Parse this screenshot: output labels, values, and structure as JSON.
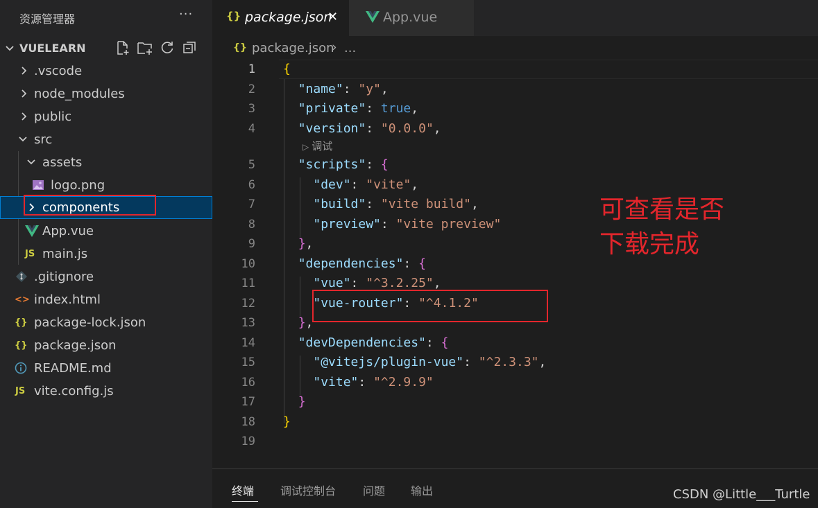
{
  "explorer": {
    "title": "资源管理器",
    "more_label": "···",
    "project_name": "VUELEARN",
    "tree": [
      {
        "label": ".vscode",
        "kind": "folder",
        "expanded": false
      },
      {
        "label": "node_modules",
        "kind": "folder",
        "expanded": false
      },
      {
        "label": "public",
        "kind": "folder",
        "expanded": false
      },
      {
        "label": "src",
        "kind": "folder",
        "expanded": true
      },
      {
        "label": "assets",
        "kind": "folder",
        "expanded": true
      },
      {
        "label": "logo.png",
        "kind": "image"
      },
      {
        "label": "components",
        "kind": "folder",
        "expanded": false,
        "selected": true
      },
      {
        "label": "App.vue",
        "kind": "vue"
      },
      {
        "label": "main.js",
        "kind": "js",
        "icon_text": "JS"
      },
      {
        "label": ".gitignore",
        "kind": "git"
      },
      {
        "label": "index.html",
        "kind": "html",
        "icon_text": "<>"
      },
      {
        "label": "package-lock.json",
        "kind": "json",
        "icon_text": "{}"
      },
      {
        "label": "package.json",
        "kind": "json",
        "icon_text": "{}"
      },
      {
        "label": "README.md",
        "kind": "info"
      },
      {
        "label": "vite.config.js",
        "kind": "js",
        "icon_text": "JS"
      }
    ]
  },
  "tabs": [
    {
      "label": "package.json",
      "icon_text": "{}",
      "active": true,
      "close": "✕"
    },
    {
      "label": "App.vue",
      "icon": "vue-icon",
      "active": false
    }
  ],
  "breadcrumb": {
    "icon_text": "{}",
    "file": "package.json",
    "separator": "›",
    "more": "..."
  },
  "editor": {
    "code_lens": "调试",
    "lines": [
      "1",
      "2",
      "3",
      "4",
      "5",
      "6",
      "7",
      "8",
      "9",
      "10",
      "11",
      "12",
      "13",
      "14",
      "15",
      "16",
      "17",
      "18",
      "19"
    ],
    "current_line": "1"
  },
  "annotation": {
    "line1": "可查看是否",
    "line2": "下载完成"
  },
  "panel": {
    "tabs": [
      "终端",
      "调试控制台",
      "问题",
      "输出"
    ],
    "active_tab": "终端"
  },
  "watermark": "CSDN @Little___Turtle",
  "colors": {
    "accent_red": "#e3262c",
    "json_icon": "#cbcb41",
    "vue_icon": "#41b883",
    "html_icon": "#e37933",
    "info_icon": "#519aba",
    "selection": "#04395e"
  }
}
